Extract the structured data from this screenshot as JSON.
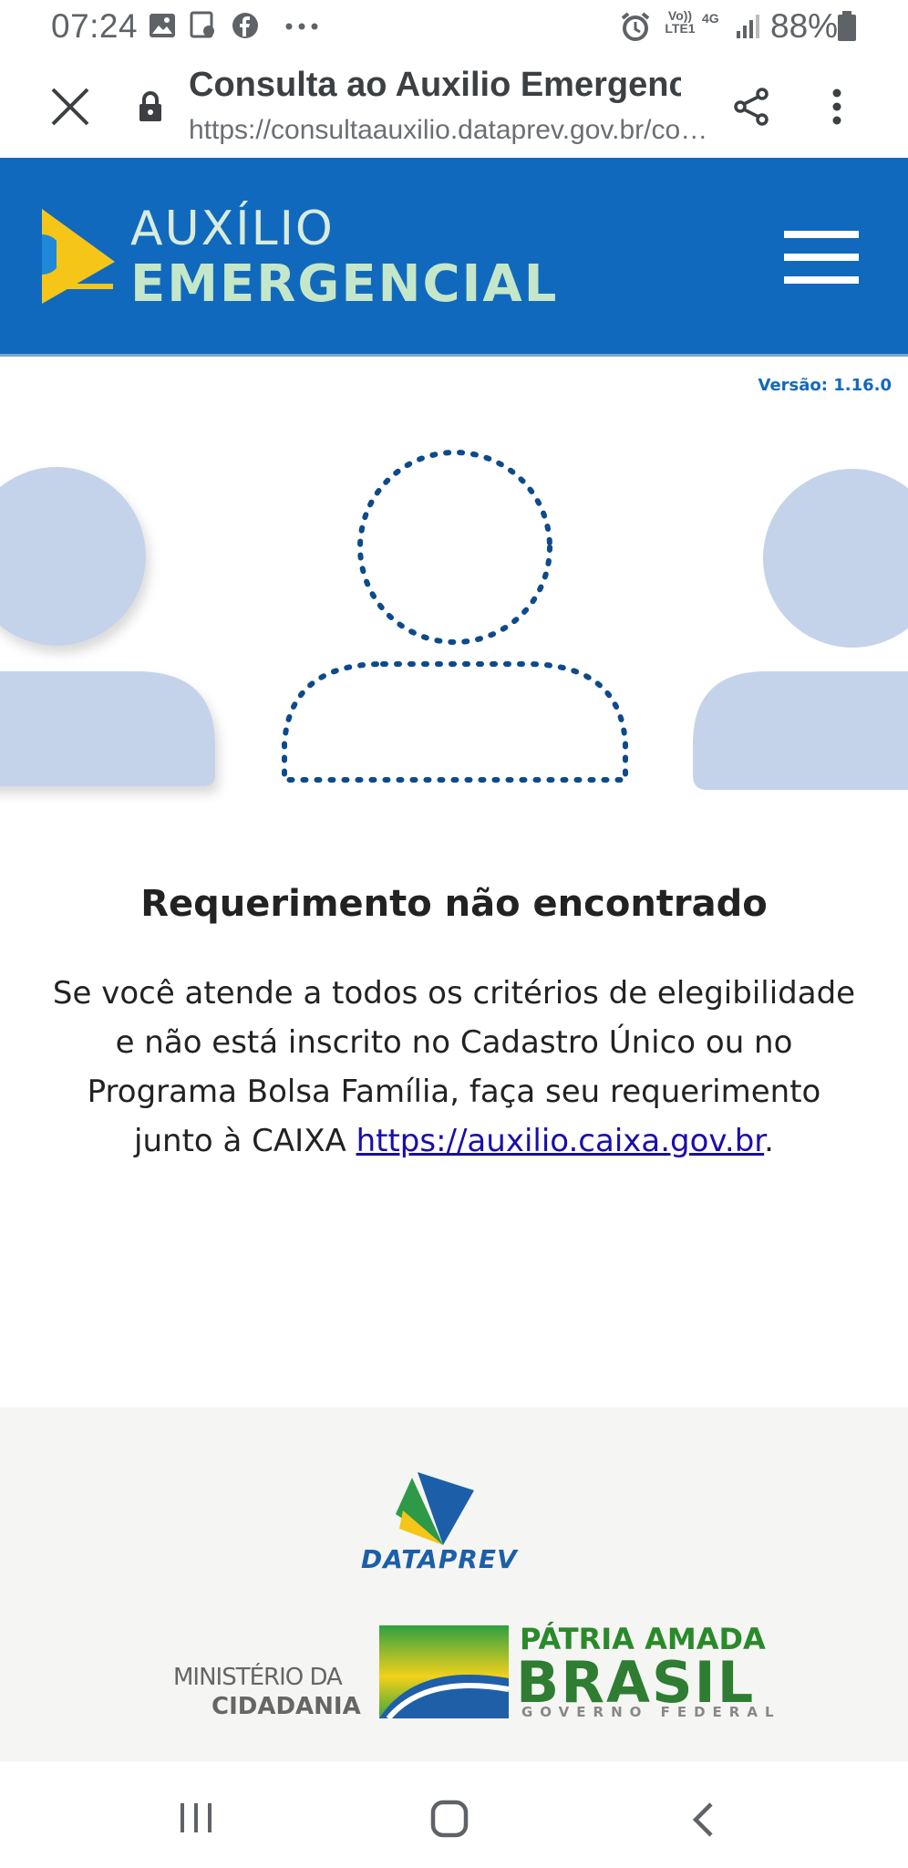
{
  "status_bar": {
    "time": "07:24",
    "battery_percent": "88%",
    "network_label_1": "Vo)) LTE1",
    "network_label_2": "4G",
    "icons": [
      "image-icon",
      "screencast-icon",
      "facebook-icon",
      "more-dots-icon",
      "alarm-icon",
      "signal-icon",
      "battery-icon"
    ]
  },
  "browser": {
    "title": "Consulta ao Auxilio Emergencial",
    "url": "https://consultaauxilio.dataprev.gov.br/consu..."
  },
  "header": {
    "logo_line1": "AUXÍLIO",
    "logo_line2": "EMERGENCIAL",
    "background_color": "#1169bd"
  },
  "version": "Versão: 1.16.0",
  "message": {
    "heading": "Requerimento não encontrado",
    "body": "Se você atende a todos os critérios de elegibilidade e não está inscrito no Cadastro Único ou no Programa Bolsa Família, faça seu requerimento junto à CAIXA ",
    "link_text": "https://auxilio.caixa.gov.br",
    "suffix": "."
  },
  "footer": {
    "dataprev_label": "DATAPREV",
    "ministerio_line1": "MINISTÉRIO DA",
    "ministerio_line2": "CIDADANIA",
    "patria_line": "PÁTRIA AMADA",
    "brasil_line": "BRASIL",
    "governo_line": "GOVERNO FEDERAL"
  }
}
